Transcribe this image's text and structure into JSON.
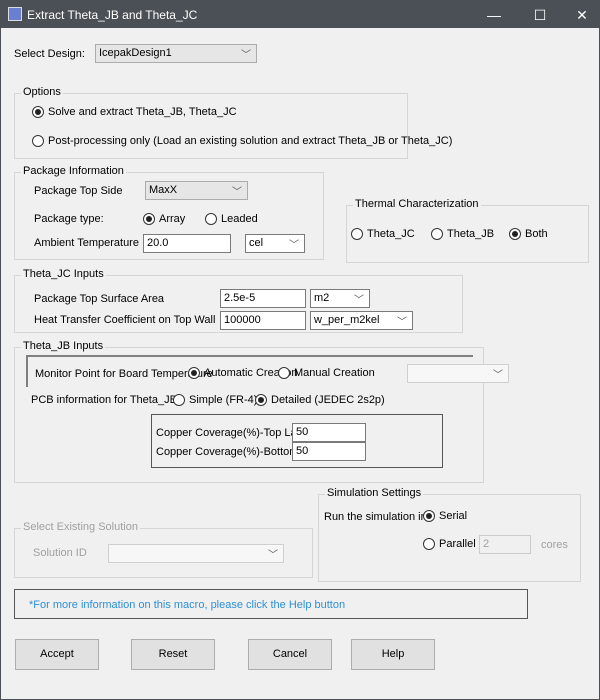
{
  "window": {
    "title": "Extract Theta_JB and Theta_JC",
    "minimize": "—",
    "maximize": "☐",
    "close": "✕"
  },
  "design": {
    "label": "Select Design:",
    "value": "IcepakDesign1"
  },
  "options": {
    "legend": "Options",
    "solve": "Solve and extract Theta_JB, Theta_JC",
    "post": "Post-processing only (Load an existing solution and extract Theta_JB or Theta_JC)"
  },
  "package": {
    "legend": "Package Information",
    "top_side_label": "Package Top Side",
    "top_side": "MaxX",
    "type_label": "Package type:",
    "array": "Array",
    "leaded": "Leaded",
    "ambient_label": "Ambient Temperature",
    "ambient": "20.0",
    "ambient_unit": "cel"
  },
  "thermal": {
    "legend": "Thermal Characterization",
    "jc": "Theta_JC",
    "jb": "Theta_JB",
    "both": "Both"
  },
  "jc_inputs": {
    "legend": "Theta_JC Inputs",
    "area_label": "Package Top Surface Area",
    "area": "2.5e-5",
    "area_unit": "m2",
    "htc_label": "Heat Transfer Coefficient on Top Wall",
    "htc": "100000",
    "htc_unit": "w_per_m2kel"
  },
  "jb_inputs": {
    "legend": "Theta_JB Inputs",
    "monitor_label": "Monitor Point for Board Temperature",
    "auto": "Automatic Creation",
    "manual": "Manual Creation",
    "pcb_label": "PCB information for Theta_JB",
    "simple": "Simple (FR-4)",
    "detailed": "Detailed (JEDEC 2s2p)",
    "top_label": "Copper Coverage(%)-Top Layer",
    "top": "50",
    "bottom_label": "Copper Coverage(%)-Bottom Layer",
    "bottom": "50"
  },
  "existing": {
    "legend": "Select Existing Solution",
    "id_label": "Solution ID"
  },
  "sim": {
    "legend": "Simulation Settings",
    "run_label": "Run the simulation in:",
    "serial": "Serial",
    "parallel": "Parallel",
    "cores": "2",
    "cores_label": "cores"
  },
  "info": "*For more information on this macro, please click the Help button",
  "buttons": {
    "accept": "Accept",
    "reset": "Reset",
    "cancel": "Cancel",
    "help": "Help"
  }
}
